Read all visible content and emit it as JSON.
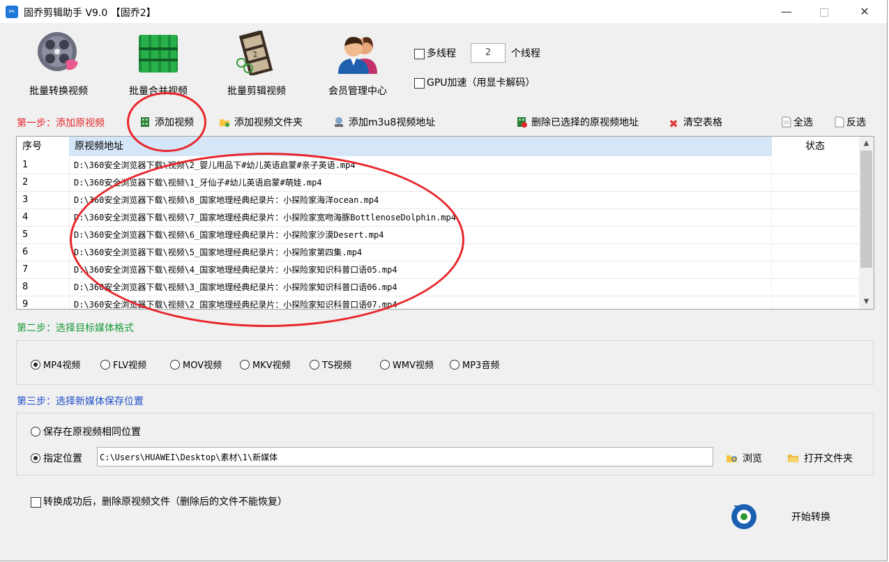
{
  "window": {
    "title": "固乔剪辑助手 V9.0 【固乔2】",
    "app_icon": "scissors-icon",
    "minimize": "—",
    "close": "✕"
  },
  "toolbar": {
    "batch_convert": "批量转换视频",
    "batch_merge": "批量合并视频",
    "batch_edit": "批量剪辑视频",
    "member_center": "会员管理中心"
  },
  "options": {
    "multithread_label": "多线程",
    "thread_count": "2",
    "thread_unit": "个线程",
    "gpu_label": "GPU加速（用显卡解码）"
  },
  "step1": {
    "label": "第一步：添加原视频",
    "add_video": "添加视频",
    "add_folder": "添加视频文件夹",
    "add_m3u8": "添加m3u8视频地址",
    "delete_selected": "删除已选择的原视频地址",
    "clear_table": "清空表格",
    "select_all": "全选",
    "invert_select": "反选"
  },
  "table": {
    "columns": [
      "序号",
      "原视频地址",
      "状态"
    ],
    "rows": [
      {
        "no": "1",
        "path": "D:\\360安全浏览器下载\\视频\\2_婴儿用品下#幼儿英语启蒙#亲子英语.mp4",
        "status": ""
      },
      {
        "no": "2",
        "path": "D:\\360安全浏览器下载\\视频\\1_牙仙子#幼儿英语启蒙#萌娃.mp4",
        "status": ""
      },
      {
        "no": "3",
        "path": "D:\\360安全浏览器下载\\视频\\8_国家地理经典纪录片：小探险家海洋ocean.mp4",
        "status": ""
      },
      {
        "no": "4",
        "path": "D:\\360安全浏览器下载\\视频\\7_国家地理经典纪录片：小探险家宽吻海豚BottlenoseDolphin.mp4",
        "status": ""
      },
      {
        "no": "5",
        "path": "D:\\360安全浏览器下载\\视频\\6_国家地理经典纪录片：小探险家沙漠Desert.mp4",
        "status": ""
      },
      {
        "no": "6",
        "path": "D:\\360安全浏览器下载\\视频\\5_国家地理经典纪录片：小探险家第四集.mp4",
        "status": ""
      },
      {
        "no": "7",
        "path": "D:\\360安全浏览器下载\\视频\\4_国家地理经典纪录片：小探险家知识科普口语05.mp4",
        "status": ""
      },
      {
        "no": "8",
        "path": "D:\\360安全浏览器下载\\视频\\3_国家地理经典纪录片：小探险家知识科普口语06.mp4",
        "status": ""
      },
      {
        "no": "9",
        "path": "D:\\360安全浏览器下载\\视频\\2_国家地理经典纪录片：小探险家知识科普口语07.mp4",
        "status": ""
      }
    ]
  },
  "step2": {
    "label": "第二步：选择目标媒体格式",
    "formats": [
      "MP4视频",
      "FLV视频",
      "MOV视频",
      "MKV视频",
      "TS视频",
      "WMV视频",
      "MP3音频"
    ],
    "selected": "MP4视频"
  },
  "step3": {
    "label": "第三步：选择新媒体保存位置",
    "same_location": "保存在原视频相同位置",
    "specify_location": "指定位置",
    "path": "C:\\Users\\HUAWEI\\Desktop\\素材\\1\\新媒体",
    "browse": "浏览",
    "open_folder": "打开文件夹"
  },
  "footer": {
    "delete_after": "转换成功后，删除原视频文件（删除后的文件不能恢复）",
    "start": "开始转换"
  },
  "colors": {
    "step1": "#e4262c",
    "step2": "#179a3a",
    "step3": "#1e4fc8",
    "header_highlight": "#d5e6f8",
    "annotation": "#e8252a"
  }
}
